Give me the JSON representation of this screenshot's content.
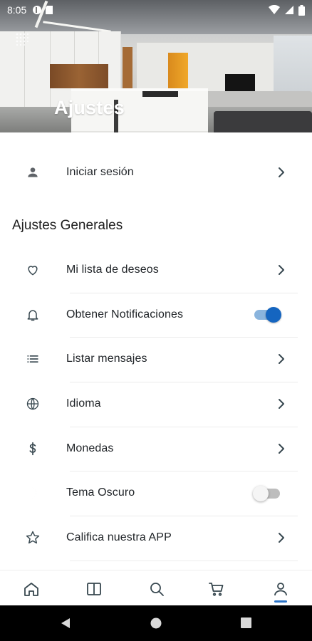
{
  "status_bar": {
    "time": "8:05"
  },
  "header": {
    "title": "Ajustes"
  },
  "account": {
    "login_label": "Iniciar sesión"
  },
  "general_section": {
    "title": "Ajustes Generales",
    "items": [
      {
        "label": "Mi lista de deseos",
        "icon": "heart-icon",
        "control": "chevron"
      },
      {
        "label": "Obtener Notificaciones",
        "icon": "bell-icon",
        "control": "toggle",
        "toggle_on": true
      },
      {
        "label": "Listar mensajes",
        "icon": "list-icon",
        "control": "chevron"
      },
      {
        "label": "Idioma",
        "icon": "globe-icon",
        "control": "chevron"
      },
      {
        "label": "Monedas",
        "icon": "dollar-icon",
        "control": "chevron"
      },
      {
        "label": "Tema Oscuro",
        "icon": "moon-icon",
        "control": "toggle",
        "toggle_on": false
      },
      {
        "label": "Califica nuestra APP",
        "icon": "star-icon",
        "control": "chevron"
      }
    ]
  },
  "bottom_nav": {
    "items": [
      "home-icon",
      "categories-icon",
      "search-icon",
      "cart-icon",
      "profile-icon"
    ],
    "active": "profile-icon"
  },
  "colors": {
    "accent": "#1565c0",
    "icon": "#37474f",
    "active_nav": "#2c74c7"
  }
}
